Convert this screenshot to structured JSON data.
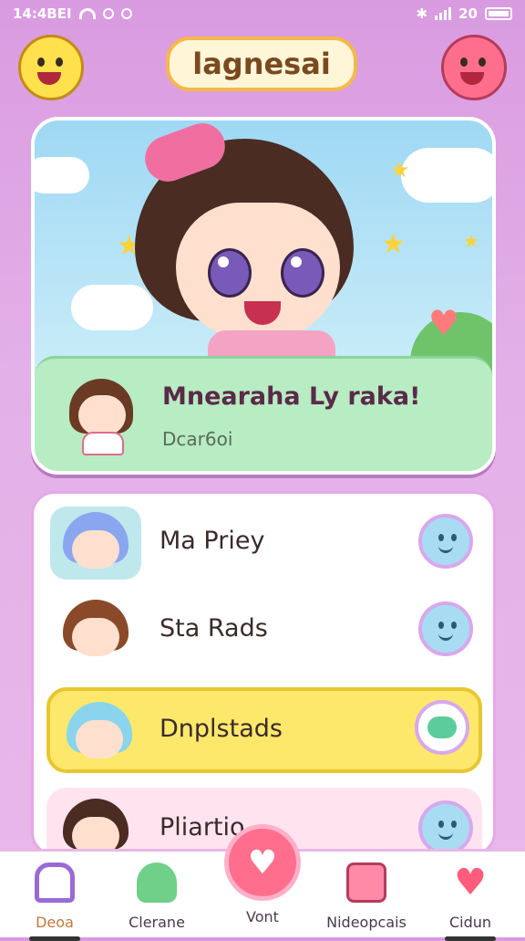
{
  "status": {
    "time": "14:4BEI",
    "right": "20"
  },
  "header": {
    "title": "lagnesai"
  },
  "hero": {
    "title": "Mnearaha Ly raka!",
    "subtitle": "Dcar6oi"
  },
  "list": {
    "items": [
      {
        "label": "Ma Priey"
      },
      {
        "label": "Sta Rads"
      },
      {
        "label": "Dnplstads"
      },
      {
        "label": "Pliartio"
      }
    ]
  },
  "nav": {
    "items": [
      {
        "label": "Deoa"
      },
      {
        "label": "Clerane"
      },
      {
        "label": "Vont"
      },
      {
        "label": "Nideopcais"
      },
      {
        "label": "Cidun"
      }
    ]
  },
  "colors": {
    "accent": "#ff6f8d",
    "background": "#d99be0",
    "highlight": "#fde86c"
  }
}
